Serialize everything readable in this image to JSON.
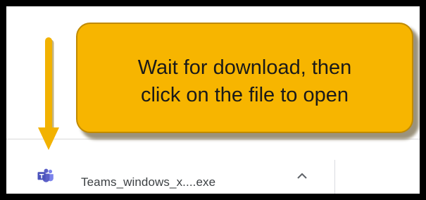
{
  "callout": {
    "line1": "Wait for download, then",
    "line2": "click on the file to open",
    "fill_color": "#F7B500",
    "border_color": "#C08A00"
  },
  "download_shelf": {
    "item": {
      "icon": "teams-icon",
      "file_name": "Teams_windows_x....exe",
      "menu_icon": "chevron-up-icon",
      "icon_color": "#5B5FC7"
    }
  },
  "annotation": {
    "arrow_icon": "arrow-down-icon",
    "arrow_color": "#F2B200"
  }
}
